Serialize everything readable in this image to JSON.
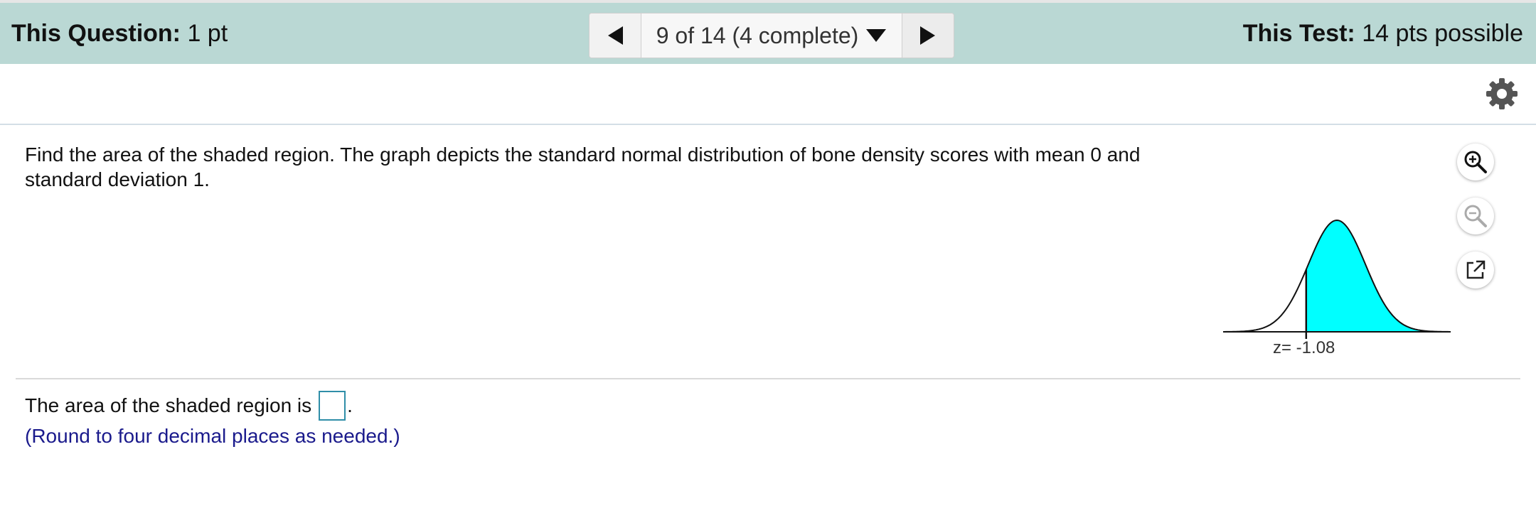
{
  "header": {
    "question_label": "This Question:",
    "question_points": "1 pt",
    "test_label": "This Test:",
    "test_points": "14 pts possible",
    "nav": {
      "position": "9 of 14 (4 complete)",
      "prev_icon": "triangle-left-icon",
      "next_icon": "triangle-right-icon",
      "dropdown_icon": "triangle-down-icon"
    }
  },
  "toolbar": {
    "settings_icon": "gear-icon"
  },
  "question": {
    "text": "Find the area of the shaded region. The graph depicts the standard normal distribution of bone density scores with mean 0 and standard deviation 1.",
    "tools": [
      "zoom-in-icon",
      "zoom-out-icon",
      "popout-icon"
    ]
  },
  "graph": {
    "z_label": "z= -1.08",
    "shade_color": "#00ffff"
  },
  "answer": {
    "prefix": "The area of the shaded region is",
    "suffix": ".",
    "value": "",
    "hint": "(Round to four decimal places as needed.)"
  },
  "colors": {
    "header_bg": "#bad8d4",
    "hint_text": "#1a1a8c",
    "input_border": "#2f8ea8"
  }
}
